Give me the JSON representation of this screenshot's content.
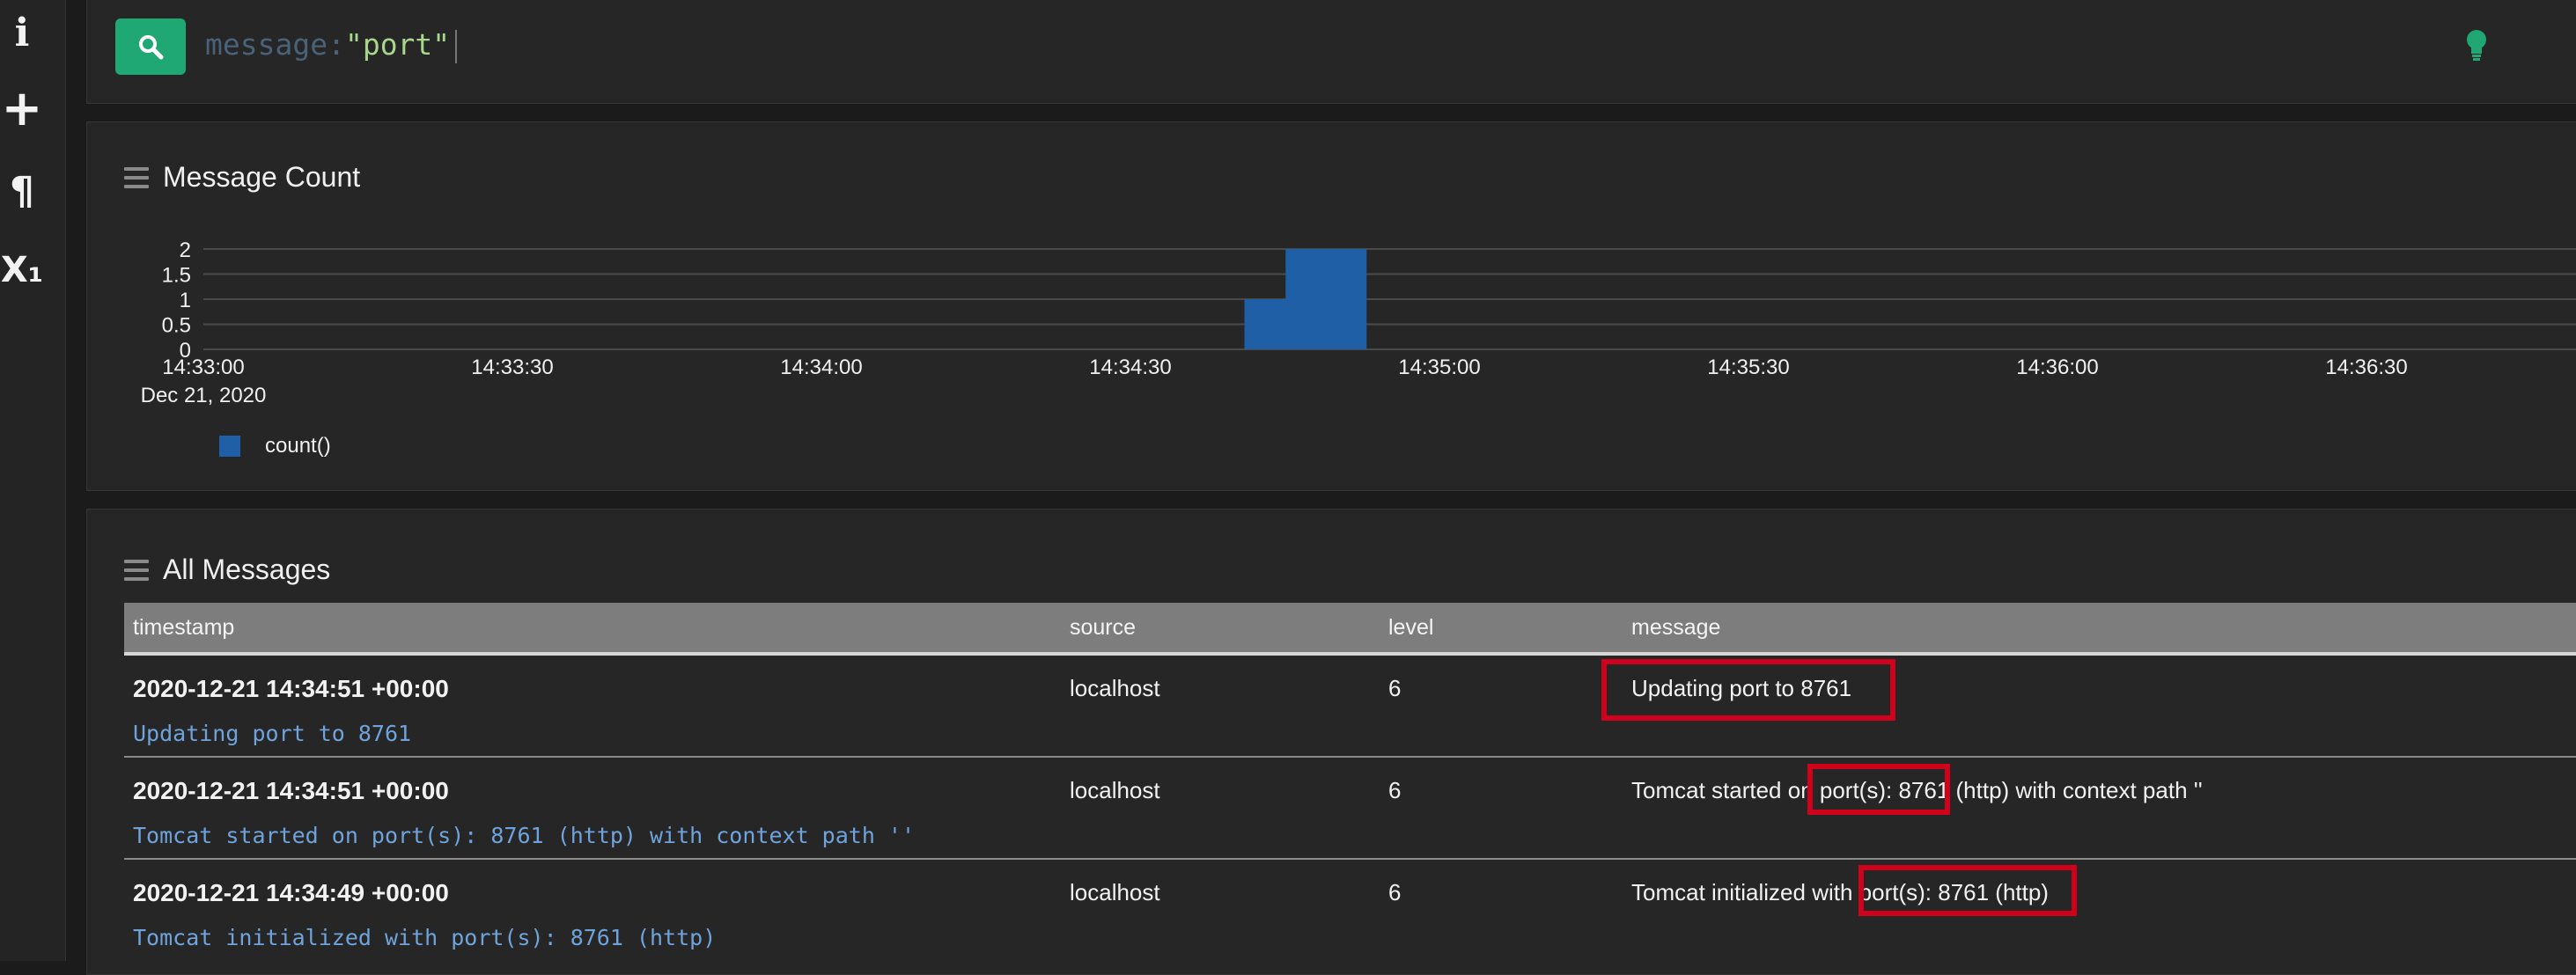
{
  "sidebar": {
    "icons": [
      {
        "name": "info-icon",
        "glyph": "i"
      },
      {
        "name": "plus-icon",
        "glyph": "+"
      },
      {
        "name": "pilcrow-icon",
        "glyph": "¶"
      },
      {
        "name": "subscript-icon",
        "glyph": "X₁"
      }
    ]
  },
  "search": {
    "field": "message:",
    "value": "\"port\""
  },
  "histogram": {
    "title": "Message Count"
  },
  "chart_data": {
    "type": "bar",
    "title": "Message Count",
    "x_ticks": [
      "14:33:00",
      "14:33:30",
      "14:34:00",
      "14:34:30",
      "14:35:00",
      "14:35:30",
      "14:36:00",
      "14:36:30"
    ],
    "x_date_label": "Dec 21, 2020",
    "y_ticks": [
      "2",
      "1.5",
      "1",
      "0.5",
      "0"
    ],
    "ylim": [
      0,
      2
    ],
    "grid": true,
    "legend": "bottom-left",
    "series": [
      {
        "name": "count()",
        "color": "#1f5fa5",
        "points": [
          {
            "x": "14:34:45",
            "y": 1
          },
          {
            "x": "14:34:49",
            "y": 2
          }
        ]
      }
    ]
  },
  "messages": {
    "title": "All Messages",
    "columns": [
      "timestamp",
      "source",
      "level",
      "message"
    ],
    "rows": [
      {
        "timestamp": "2020-12-21 14:34:51 +00:00",
        "source": "localhost",
        "level": "6",
        "message": "Updating port to 8761",
        "full": "Updating port to 8761"
      },
      {
        "timestamp": "2020-12-21 14:34:51 +00:00",
        "source": "localhost",
        "level": "6",
        "message": "Tomcat started on port(s): 8761 (http) with context path ''",
        "full": "Tomcat started on port(s): 8761 (http) with context path ''"
      },
      {
        "timestamp": "2020-12-21 14:34:49 +00:00",
        "source": "localhost",
        "level": "6",
        "message": "Tomcat initialized with port(s): 8761 (http)",
        "full": "Tomcat initialized with port(s): 8761 (http)"
      }
    ]
  },
  "colors": {
    "accent": "#1fa774",
    "bar": "#1f5fa5",
    "highlight": "#d0021b",
    "subtext": "#6fa3dc"
  }
}
